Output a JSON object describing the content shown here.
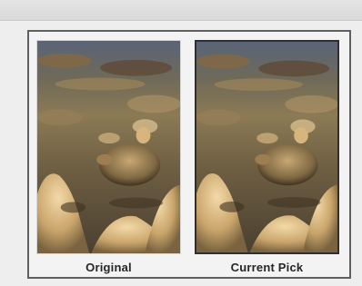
{
  "comparison": {
    "original_label": "Original",
    "current_label": "Current Pick",
    "selected": "current"
  },
  "image": {
    "subject": "tortoise-on-rocks-photo"
  },
  "colors": {
    "panel_border": "#5f5f5f",
    "selected_border": "#2f2f2f",
    "background": "#eeeeee",
    "caption_text": "#262626"
  }
}
